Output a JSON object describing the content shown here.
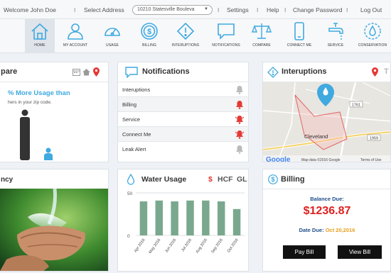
{
  "topbar": {
    "welcome": "Welcome John Doe",
    "select_address_label": "Select Address",
    "address_value": "10210 Statesville Bouleva",
    "settings": "Settings",
    "help": "Help",
    "change_password": "Change Password",
    "logout": "Log Out",
    "separator": "I"
  },
  "nav": [
    {
      "label": "HOME",
      "icon": "home-icon"
    },
    {
      "label": "MY ACCOUNT",
      "icon": "user-icon"
    },
    {
      "label": "USAGE",
      "icon": "gauge-icon"
    },
    {
      "label": "BILLING",
      "icon": "dollar-icon"
    },
    {
      "label": "INTERUPTIONS",
      "icon": "warning-icon"
    },
    {
      "label": "NOTIFICATIONS",
      "icon": "chat-bubble-icon"
    },
    {
      "label": "COMPARE",
      "icon": "scales-icon"
    },
    {
      "label": "CONNECT ME",
      "icon": "phone-icon"
    },
    {
      "label": "SERVICE",
      "icon": "faucet-icon"
    },
    {
      "label": "CONSERVATION",
      "icon": "water-drop-icon"
    }
  ],
  "compare": {
    "title": "pare",
    "pct_text": "% More Usage than",
    "sub_text": "hers in your zip code."
  },
  "efficiency": {
    "title": "ncy"
  },
  "notifications": {
    "title": "Notifications",
    "items": [
      {
        "label": "Interuptions",
        "active": false
      },
      {
        "label": "Billing",
        "active": true
      },
      {
        "label": "Service",
        "active": true
      },
      {
        "label": "Connect Me",
        "active": true
      },
      {
        "label": "Leak Alert",
        "active": false
      }
    ]
  },
  "interruptions": {
    "title": "Interuptions",
    "map_city": "Cleveland",
    "route_1": "1761",
    "route_2": "1959",
    "map_logo": "Google",
    "map_credit": "Map data ©2016 Google",
    "map_terms": "Terms of Use"
  },
  "water_usage": {
    "title": "Water Usage",
    "units": [
      "$",
      "HCF",
      "GL"
    ]
  },
  "chart_data": {
    "type": "bar",
    "categories": [
      "Apr 2016",
      "May 2016",
      "Jun 2016",
      "Jul 2016",
      "Aug 2016",
      "Sep 2016",
      "Oct 2016"
    ],
    "values": [
      40,
      41,
      40,
      41,
      41,
      40,
      31
    ],
    "ylim": [
      0,
      50
    ],
    "yticks": [
      0,
      50
    ],
    "bar_color": "#7aa88e"
  },
  "billing": {
    "title": "Billing",
    "balance_label": "Balance Due:",
    "balance_value": "$1236.87",
    "date_label": "Date Due:",
    "date_value": "Oct 20,2016",
    "pay_button": "Pay Bill",
    "view_button": "View Bill"
  },
  "colors": {
    "accent": "#3fa9e0",
    "alert": "#e53935",
    "balance": "#e02020",
    "date_due": "#e8a020"
  }
}
